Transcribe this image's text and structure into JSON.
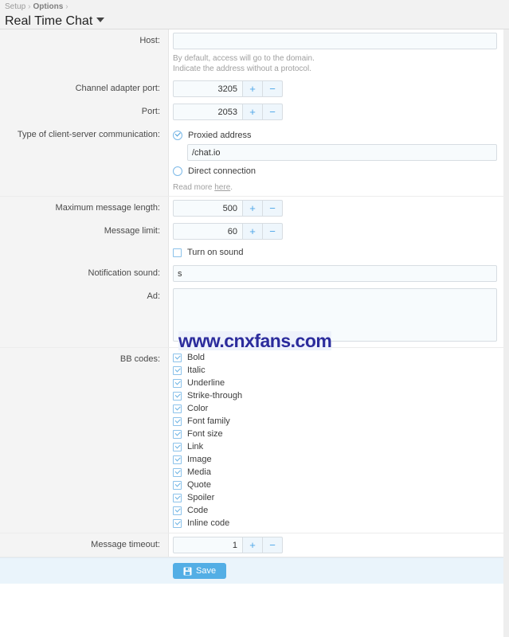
{
  "header": {
    "breadcrumb": [
      "Setup",
      "Options"
    ],
    "breadcrumb_separator": "›",
    "title": "Real Time Chat",
    "caret_icon": "chevron-down-icon"
  },
  "form": {
    "host": {
      "label": "Host:",
      "value": "",
      "hint_line1": "By default, access will go to the domain.",
      "hint_line2": "Indicate the address without a protocol."
    },
    "channel_adapter_port": {
      "label": "Channel adapter port:",
      "value": "3205",
      "increment": "+",
      "decrement": "−"
    },
    "port": {
      "label": "Port:",
      "value": "2053",
      "increment": "+",
      "decrement": "−"
    },
    "communication_type": {
      "label": "Type of client-server communication:",
      "options": [
        {
          "label": "Proxied address",
          "selected": true
        },
        {
          "label": "Direct connection",
          "selected": false
        }
      ],
      "proxied_address_value": "/chat.io",
      "read_more_prefix": "Read more ",
      "read_more_link": "here",
      "read_more_suffix": "."
    },
    "maximum_message_length": {
      "label": "Maximum message length:",
      "value": "500",
      "increment": "+",
      "decrement": "−"
    },
    "message_limit": {
      "label": "Message limit:",
      "value": "60",
      "increment": "+",
      "decrement": "−"
    },
    "turn_on_sound": {
      "label": "Turn on sound",
      "checked": false
    },
    "notification_sound": {
      "label": "Notification sound:",
      "value": "s"
    },
    "ad": {
      "label": "Ad:",
      "value": ""
    },
    "bb_codes": {
      "label": "BB codes:",
      "items": [
        {
          "label": "Bold",
          "checked": true
        },
        {
          "label": "Italic",
          "checked": true
        },
        {
          "label": "Underline",
          "checked": true
        },
        {
          "label": "Strike-through",
          "checked": true
        },
        {
          "label": "Color",
          "checked": true
        },
        {
          "label": "Font family",
          "checked": true
        },
        {
          "label": "Font size",
          "checked": true
        },
        {
          "label": "Link",
          "checked": true
        },
        {
          "label": "Image",
          "checked": true
        },
        {
          "label": "Media",
          "checked": true
        },
        {
          "label": "Quote",
          "checked": true
        },
        {
          "label": "Spoiler",
          "checked": true
        },
        {
          "label": "Code",
          "checked": true
        },
        {
          "label": "Inline code",
          "checked": true
        }
      ]
    },
    "message_timeout": {
      "label": "Message timeout:",
      "value": "1",
      "increment": "+",
      "decrement": "−"
    }
  },
  "footer": {
    "save_label": "Save",
    "save_icon": "save-disk-icon"
  },
  "watermark": {
    "text": "www.cnxfans.com"
  },
  "colors": {
    "accent": "#53aee5",
    "input_bg": "#f7fbfd",
    "gutter_bg": "#f4f4f4",
    "footer_bg": "#eaf4fb"
  }
}
